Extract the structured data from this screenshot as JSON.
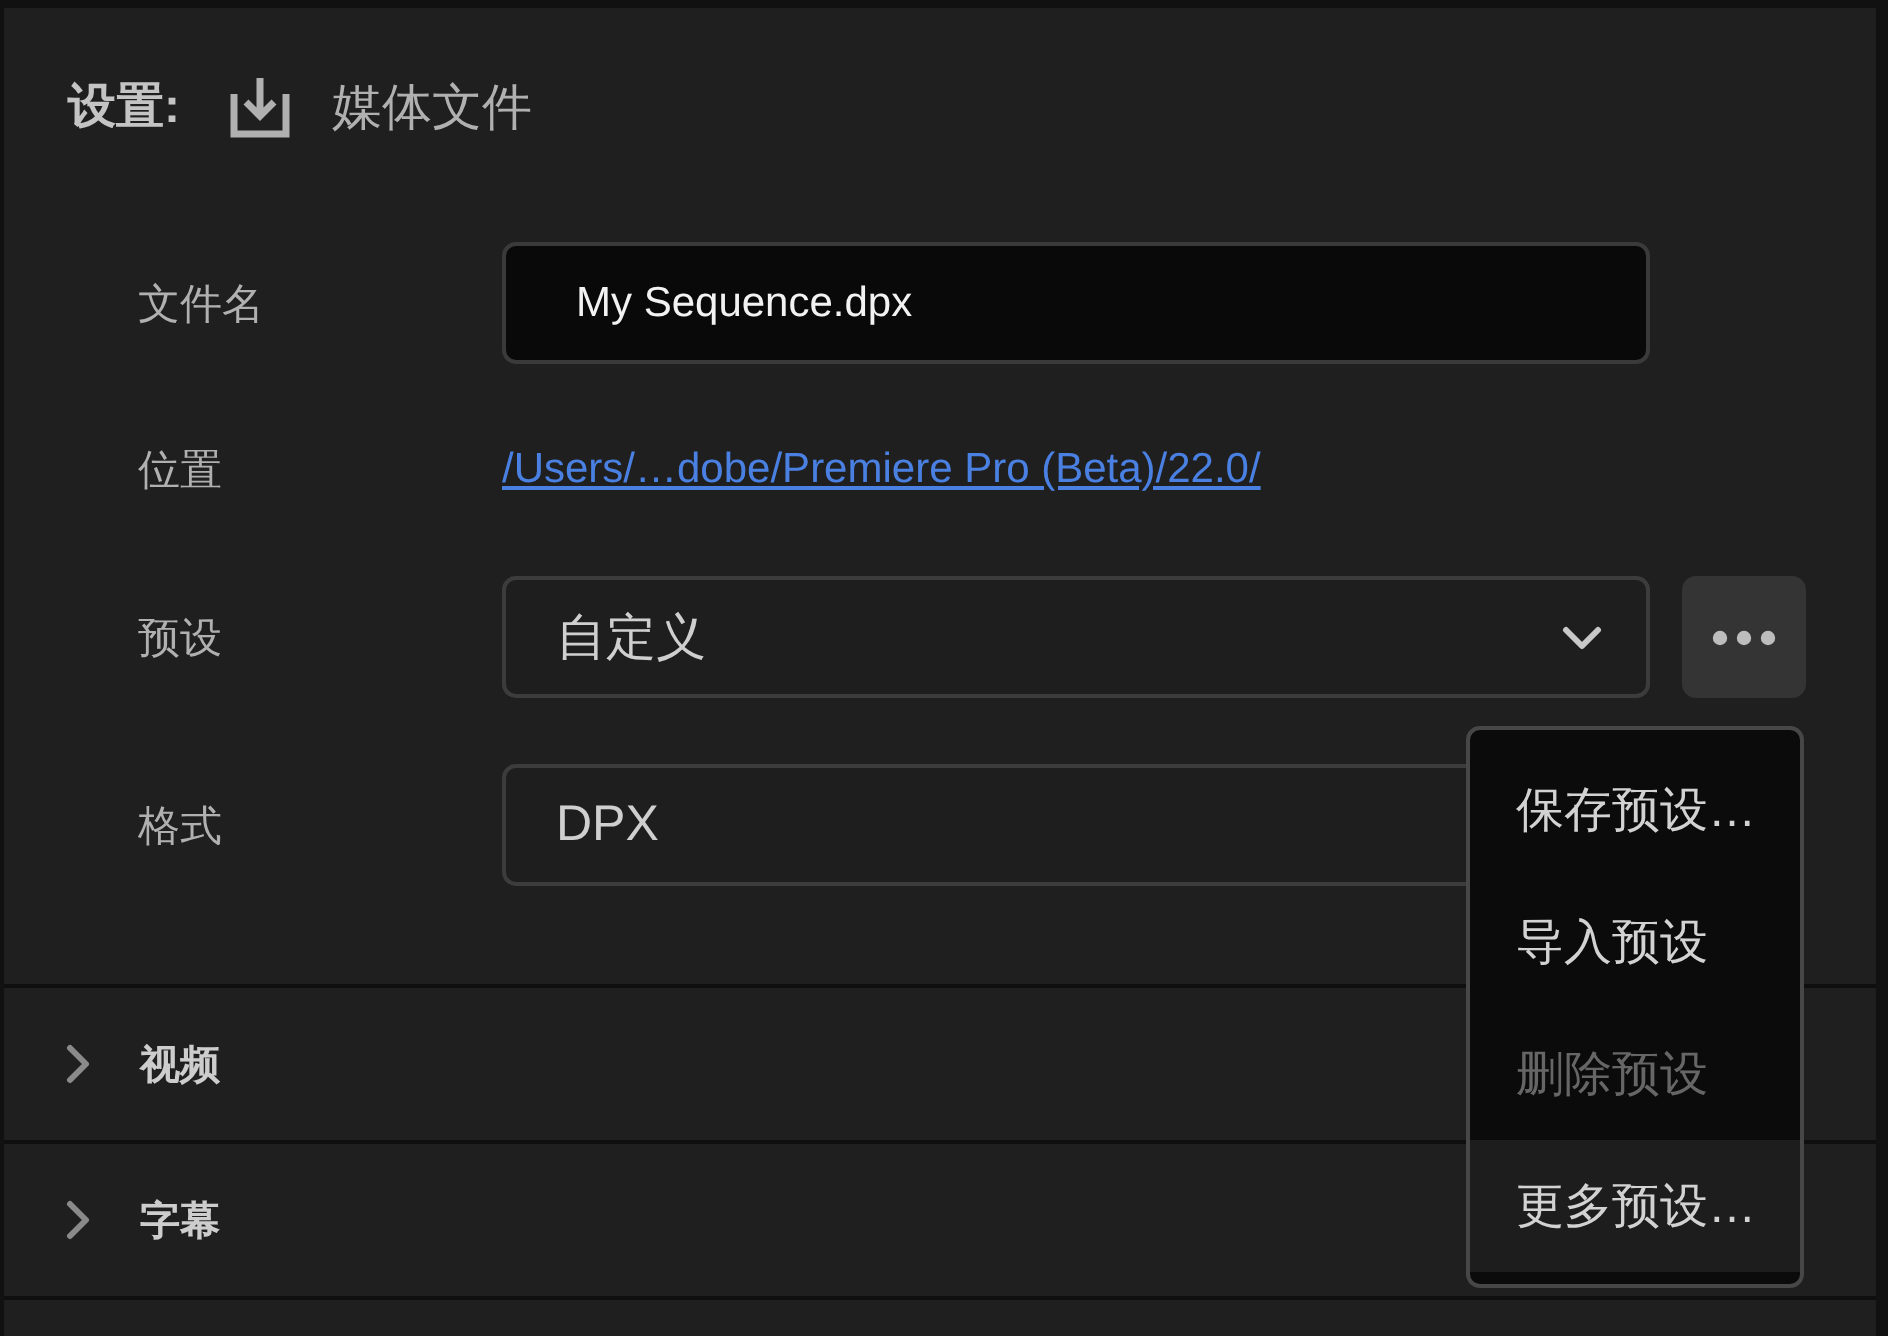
{
  "header": {
    "label": "设置:",
    "title": "媒体文件"
  },
  "fields": [
    {
      "kind": "text_input",
      "label": "文件名",
      "value": "My Sequence.dpx"
    },
    {
      "kind": "link",
      "label": "位置",
      "value": "/Users/…dobe/Premiere Pro (Beta)/22.0/"
    },
    {
      "kind": "select_with_more",
      "label": "预设",
      "value": "自定义"
    },
    {
      "kind": "select_under_menu",
      "label": "格式",
      "value": "DPX"
    }
  ],
  "preset_menu": {
    "items": [
      {
        "label": "保存预设…",
        "disabled": false,
        "highlighted": false
      },
      {
        "label": "导入预设",
        "disabled": false,
        "highlighted": false
      },
      {
        "label": "删除预设",
        "disabled": true,
        "highlighted": false
      },
      {
        "label": "更多预设…",
        "disabled": false,
        "highlighted": true
      }
    ]
  },
  "sections": [
    {
      "title": "视频",
      "expanded": false
    },
    {
      "title": "字幕",
      "expanded": false
    }
  ]
}
